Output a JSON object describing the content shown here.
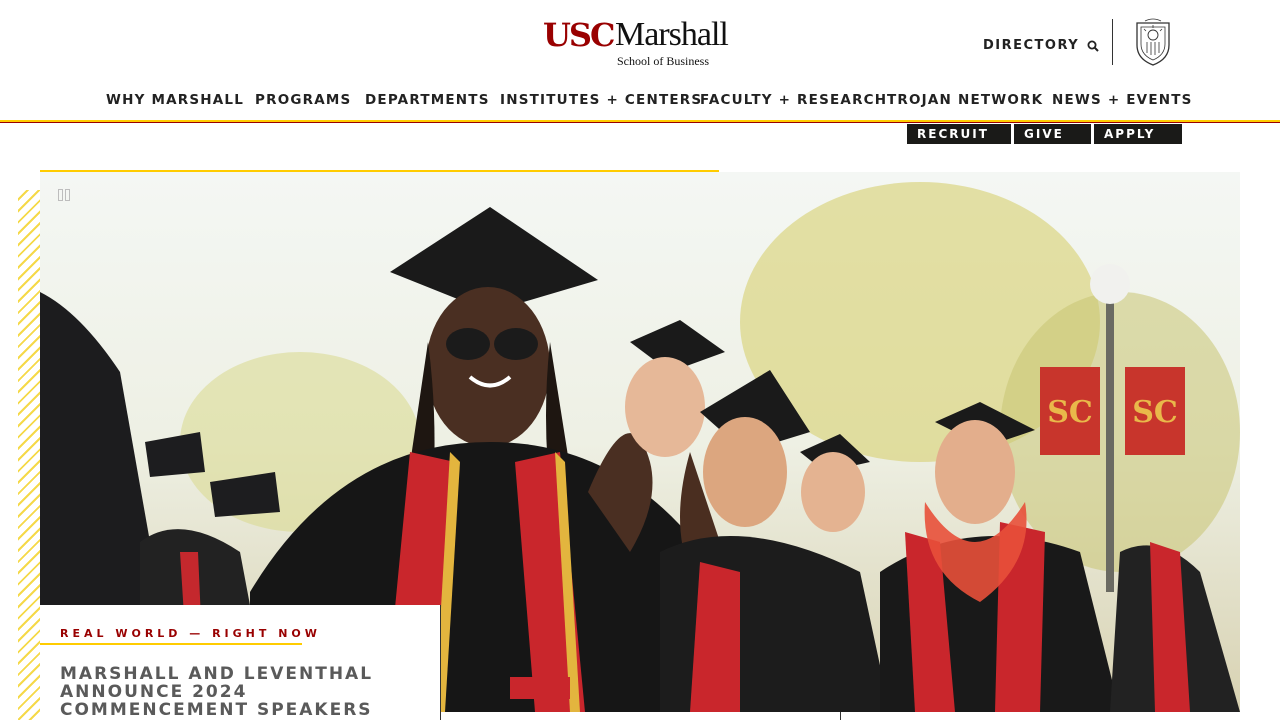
{
  "header": {
    "logo_usc": "USC",
    "logo_marshall": "Marshall",
    "logo_subtitle": "School of Business",
    "directory_label": "DIRECTORY"
  },
  "nav": {
    "items": [
      {
        "label": "WHY MARSHALL"
      },
      {
        "label": "PROGRAMS"
      },
      {
        "label": "DEPARTMENTS"
      },
      {
        "label": "INSTITUTES + CENTERS"
      },
      {
        "label": "FACULTY + RESEARCH"
      },
      {
        "label": "TROJAN NETWORK"
      },
      {
        "label": "NEWS + EVENTS"
      }
    ]
  },
  "actions": {
    "recruit": "RECRUIT",
    "give": "GIVE",
    "apply": "APPLY"
  },
  "hero": {
    "kicker": "REAL WORLD — RIGHT NOW",
    "headline": "MARSHALL AND LEVENTHAL ANNOUNCE 2024 COMMENCEMENT SPEAKERS",
    "banner_text": "SC"
  },
  "colors": {
    "cardinal": "#990000",
    "gold": "#ffcc00",
    "dark": "#1a1a18"
  },
  "icons": {
    "directory": "search-icon",
    "seal": "usc-seal-icon",
    "pause": "pause-icon"
  }
}
